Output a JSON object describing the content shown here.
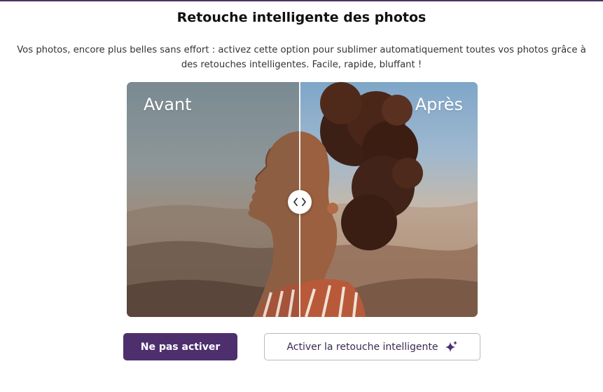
{
  "dialog": {
    "title": "Retouche intelligente des photos",
    "description": "Vos photos, encore plus belles sans effort : activez cette option pour sublimer automatiquement toutes vos photos grâce à des retouches intelligentes. Facile, rapide, bluffant !"
  },
  "comparison": {
    "before_label": "Avant",
    "after_label": "Après",
    "slider_position": 0.49,
    "handle_icon": "chevrons-left-right-icon",
    "image_subject": "smiling woman with curly hair, face to the sun, mountains in background"
  },
  "buttons": {
    "decline_label": "Ne pas activer",
    "accept_label": "Activer la retouche intelligente",
    "accept_icon": "sparkles-icon"
  },
  "colors": {
    "brand": "#4d2f6e",
    "accent_line": "#4a3560"
  }
}
